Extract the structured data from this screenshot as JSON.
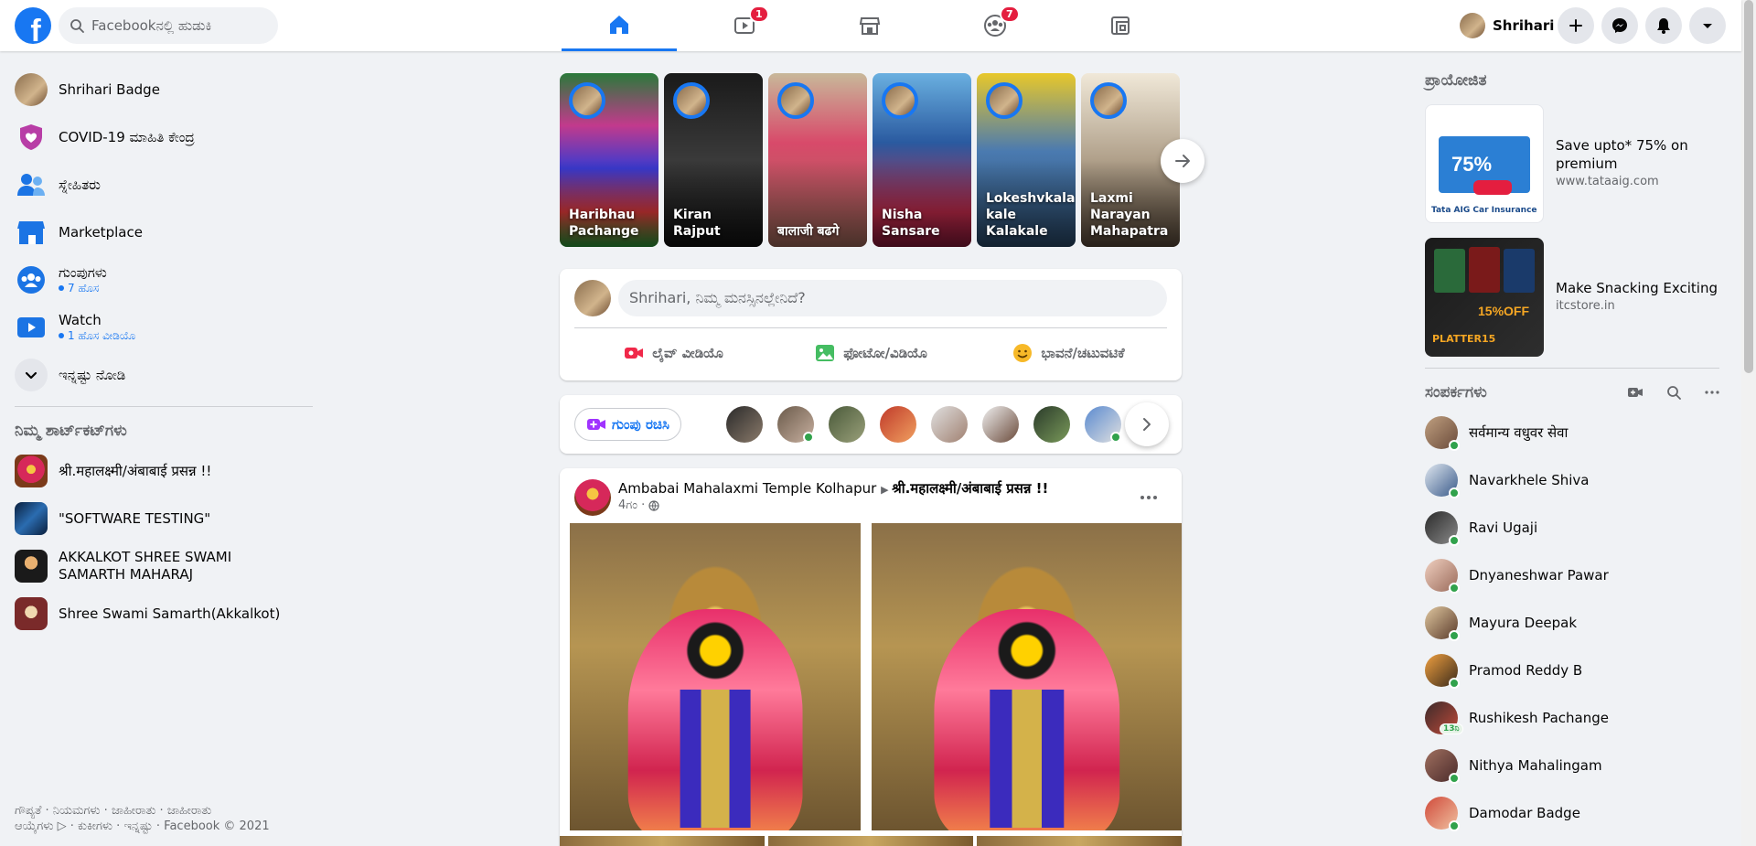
{
  "topbar": {
    "logo": "f",
    "search_placeholder": "Facebookನಲ್ಲಿ ಹುಡುಕಿ",
    "tabs": [
      {
        "name": "home",
        "badge": ""
      },
      {
        "name": "watch",
        "badge": "1"
      },
      {
        "name": "marketplace",
        "badge": ""
      },
      {
        "name": "groups",
        "badge": "7"
      },
      {
        "name": "gaming",
        "badge": ""
      }
    ],
    "profile_name": "Shrihari",
    "accent": "#1877f2"
  },
  "left": {
    "items": [
      {
        "label": "Shrihari Badge",
        "sub": ""
      },
      {
        "label": "COVID-19 ಮಾಹಿತಿ ಕೇಂದ್ರ",
        "sub": ""
      },
      {
        "label": "ಸ್ನೇಹಿತರು",
        "sub": ""
      },
      {
        "label": "Marketplace",
        "sub": ""
      },
      {
        "label": "ಗುಂಪುಗಳು",
        "sub": "7 ಹೊಸ"
      },
      {
        "label": "Watch",
        "sub": "1 ಹೊಸ ವೀಡಿಯೊ"
      },
      {
        "label": "ಇನ್ನಷ್ಟು ನೋಡಿ",
        "sub": ""
      }
    ],
    "shortcuts_title": "ನಿಮ್ಮ ಶಾರ್ಟ್‌ಕಟ್‌ಗಳು",
    "shortcuts": [
      "श्री.महालक्ष्मी/अंबाबाई प्रसन्न !!",
      "\"SOFTWARE TESTING\"",
      "AKKALKOT SHREE SWAMI SAMARTH MAHARAJ",
      "Shree Swami Samarth(Akkalkot)"
    ],
    "footer_line1": "ಗೌಪ್ಯತೆ · ನಿಯಮಗಳು · ಜಾಹೀರಾತು · ಜಾಹೀರಾತು",
    "footer_line2": "ಆಯ್ಕೆಗಳು ▷ · ಕುಕೀಗಳು · ಇನ್ನಷ್ಟು · Facebook © 2021"
  },
  "stories": [
    {
      "name": "Haribhau Pachange"
    },
    {
      "name": "Kiran Rajput"
    },
    {
      "name": "बालाजी बढगे"
    },
    {
      "name": "Nisha Sansare"
    },
    {
      "name": "Lokeshvkala kale Kalakale"
    },
    {
      "name": "Laxmi Narayan Mahapatra"
    }
  ],
  "composer": {
    "placeholder": "Shrihari, ನಿಮ್ಮ ಮನಸ್ಸಿನಲ್ಲೇನಿದೆ?",
    "live": "ಲೈವ್ ವೀಡಿಯೊ",
    "photo": "ಫೋಟೋ/ವಿಡಿಯೊ",
    "feeling": "ಭಾವನೆ/ಚಟುವಟಿಕೆ"
  },
  "rooms": {
    "button": "ಗುಂಪು ರಚಿಸಿ"
  },
  "post": {
    "author": "Ambabai Mahalaxmi Temple Kolhapur",
    "group": "श्री.महालक्ष्मी/अंबाबाई प्रसन्न !!",
    "time": "4ಗಂ",
    "privacy": "·"
  },
  "right": {
    "sponsored_title": "ಪ್ರಾಯೋಜಿತ",
    "ads": [
      {
        "title": "Save upto* 75% on premium",
        "url": "www.tataaig.com",
        "img_text": "75%",
        "img_caption": "Tata AIG Car Insurance"
      },
      {
        "title": "Make Snacking Exciting",
        "url": "itcstore.in",
        "img_text": "15%OFF",
        "img_caption": "PLATTER15"
      }
    ],
    "contacts_title": "ಸಂಪರ್ಕಗಳು",
    "contacts": [
      "सर्वमान्य वधुवर सेवा",
      "Navarkhele Shiva",
      "Ravi Ugaji",
      "Dnyaneshwar Pawar",
      "Mayura Deepak",
      "Pramod Reddy B",
      "Rushikesh Pachange",
      "Nithya Mahalingam",
      "Damodar Badge"
    ],
    "contact_badge": "13ನಿ"
  }
}
